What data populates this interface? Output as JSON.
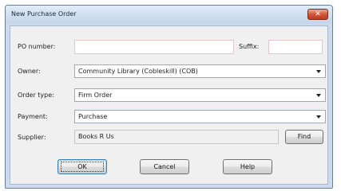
{
  "window": {
    "title": "New Purchase Order",
    "close_glyph": "✕"
  },
  "form": {
    "po_number_label": "PO number:",
    "po_number_value": "",
    "suffix_label": "Suffix:",
    "suffix_value": "",
    "owner_label": "Owner:",
    "owner_value": "Community Library (Cobleskill) (COB)",
    "order_type_label": "Order type:",
    "order_type_value": "Firm Order",
    "payment_label": "Payment:",
    "payment_value": "Purchase",
    "supplier_label": "Supplier:",
    "supplier_value": "Books R Us",
    "find_label": "Find"
  },
  "buttons": {
    "ok": "OK",
    "cancel": "Cancel",
    "help": "Help"
  },
  "colors": {
    "frame": "#ccdcee",
    "close_button": "#c94a2e",
    "required_field_border": "#e6c4c8"
  }
}
